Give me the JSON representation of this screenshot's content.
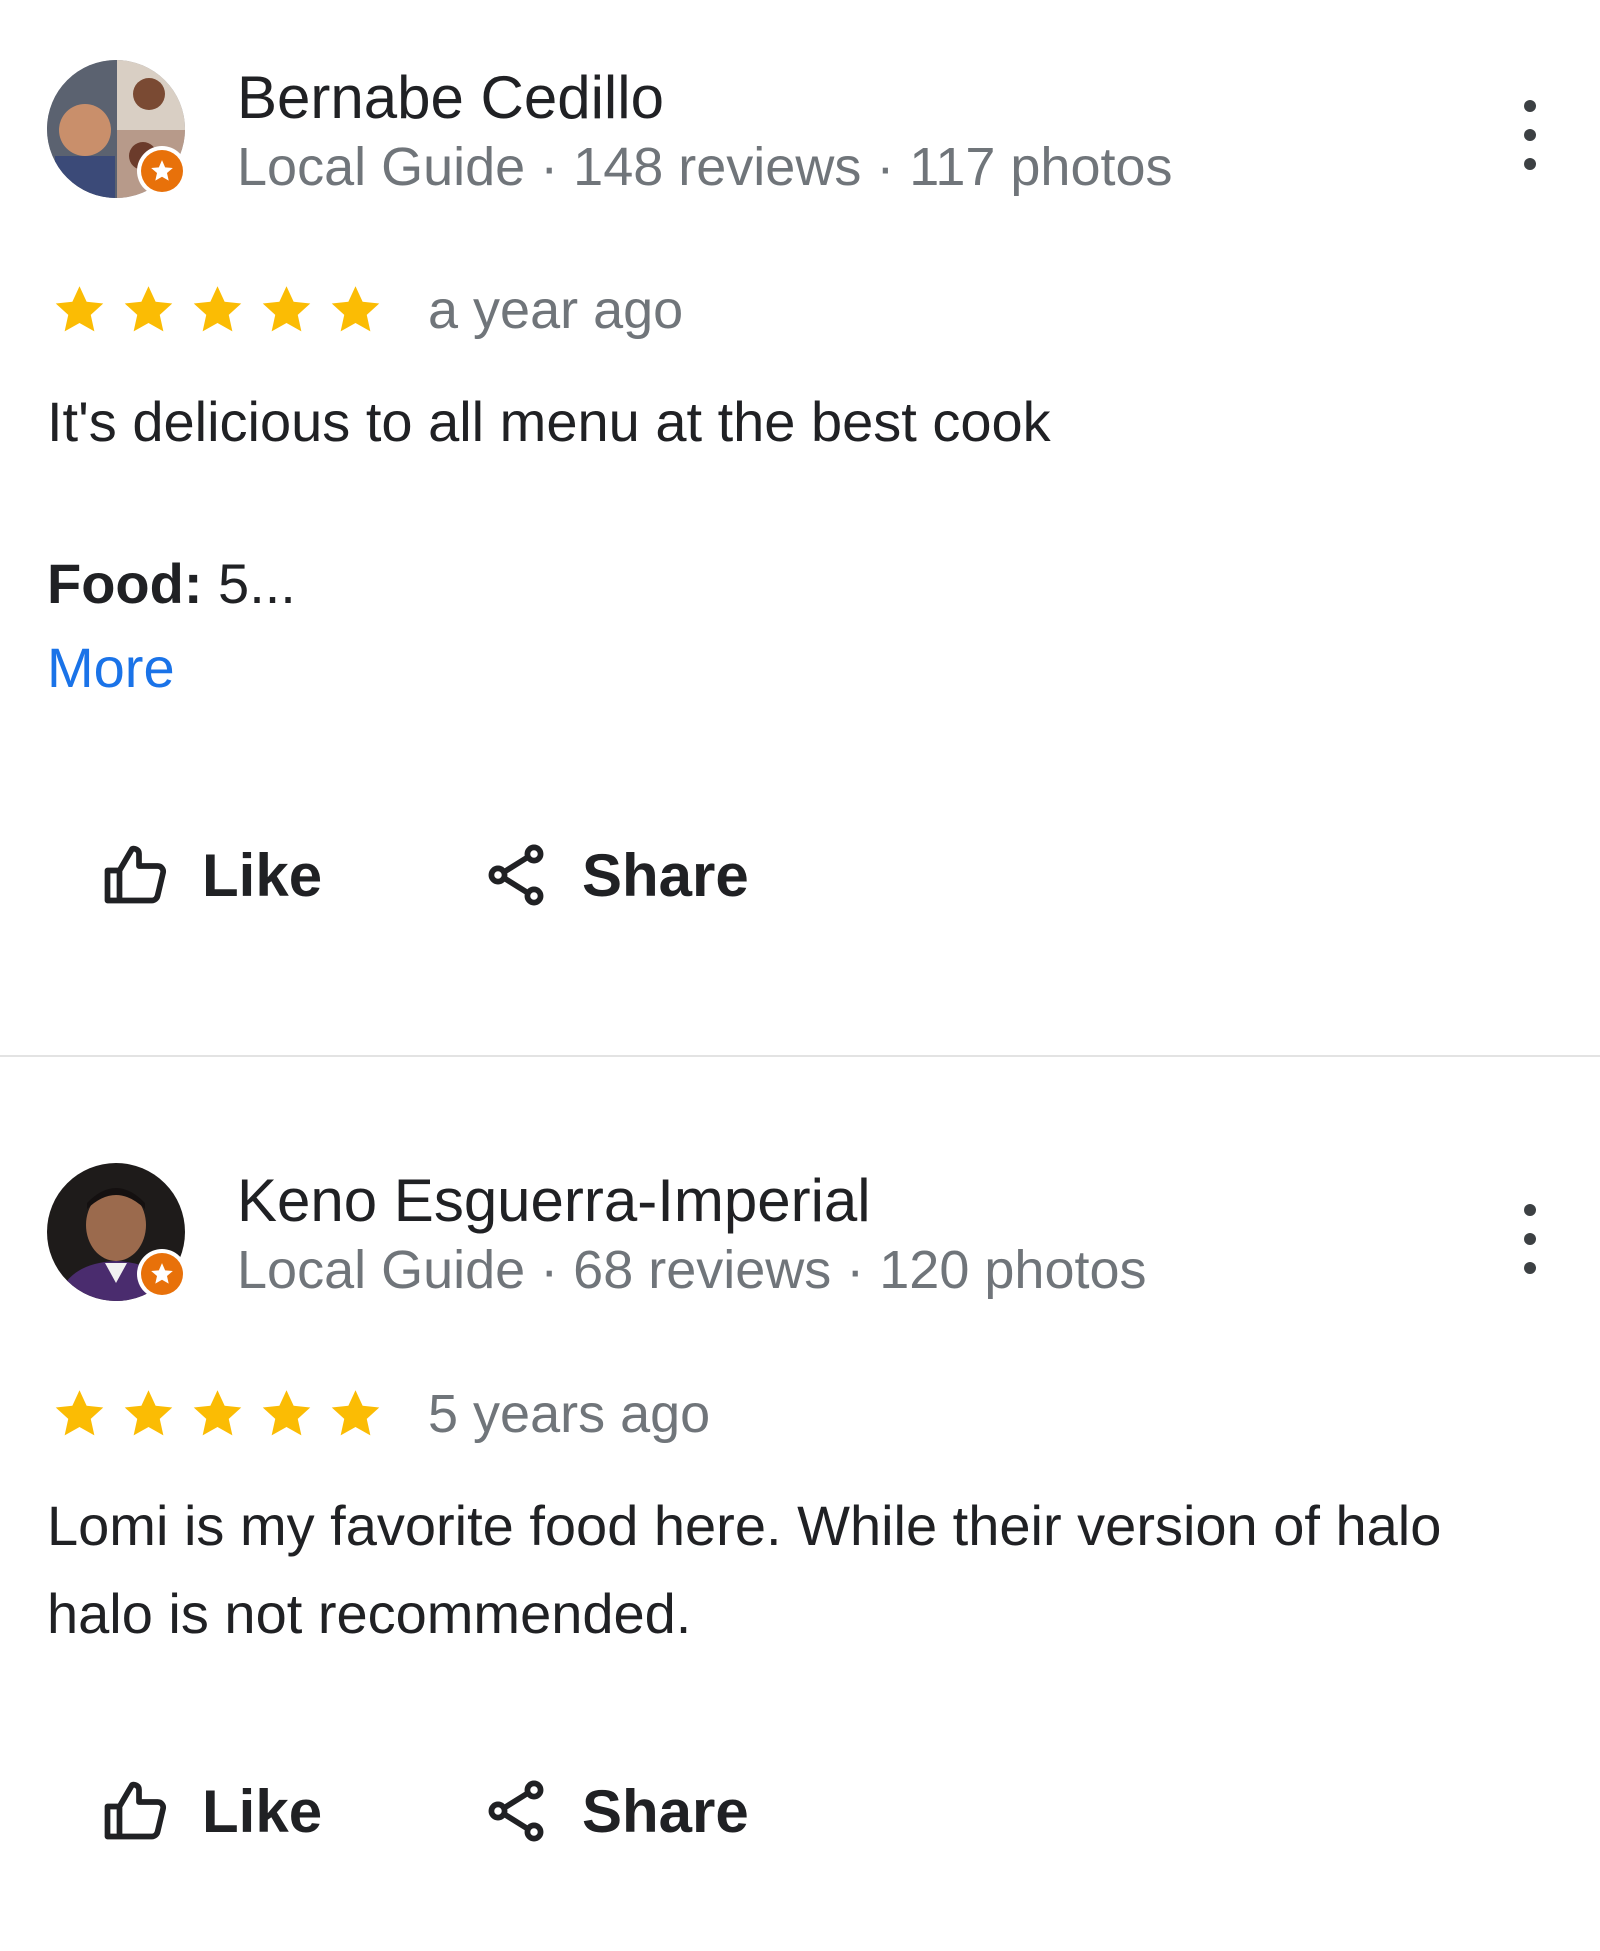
{
  "colors": {
    "star": "#fbbc04",
    "link": "#1a73e8",
    "badge": "#e8710a",
    "meta_text": "#70757a",
    "divider": "#e3e3e3"
  },
  "reviews": [
    {
      "author": "Bernabe Cedillo",
      "meta": "Local Guide · 148 reviews · 117 photos",
      "rating": 5,
      "date": "a year ago",
      "text": "It's delicious to all menu at the best cook",
      "food_label": "Food:",
      "food_value": " 5...",
      "more_label": "More",
      "like_label": "Like",
      "share_label": "Share"
    },
    {
      "author": "Keno Esguerra-Imperial",
      "meta": "Local Guide · 68 reviews · 120 photos",
      "rating": 5,
      "date": "5 years ago",
      "text": "Lomi is my favorite food here. While their version of halo halo is not recommended.",
      "like_label": "Like",
      "share_label": "Share"
    }
  ]
}
